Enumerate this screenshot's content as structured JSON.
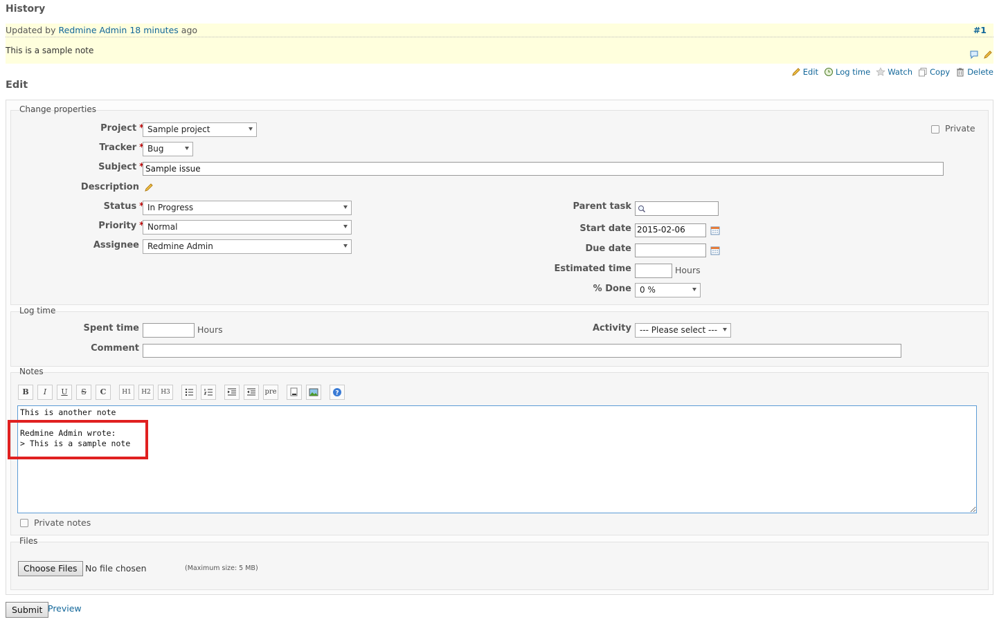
{
  "history": {
    "title": "History",
    "journal": {
      "updated_by_prefix": "Updated by",
      "author": "Redmine Admin",
      "time_ago": "18 minutes",
      "ago_suffix": "ago",
      "number": "#1",
      "note": "This is a sample note"
    }
  },
  "contextual": {
    "edit": "Edit",
    "log_time": "Log time",
    "watch": "Watch",
    "copy": "Copy",
    "delete": "Delete"
  },
  "edit_title": "Edit",
  "change_properties": {
    "legend": "Change properties",
    "project": {
      "label": "Project",
      "value": "Sample project"
    },
    "tracker": {
      "label": "Tracker",
      "value": "Bug"
    },
    "subject": {
      "label": "Subject",
      "value": "Sample issue"
    },
    "description": {
      "label": "Description"
    },
    "private_label": "Private",
    "status": {
      "label": "Status",
      "value": "In Progress"
    },
    "priority": {
      "label": "Priority",
      "value": "Normal"
    },
    "assignee": {
      "label": "Assignee",
      "value": "Redmine Admin"
    },
    "parent_task": {
      "label": "Parent task",
      "value": ""
    },
    "start_date": {
      "label": "Start date",
      "value": "2015-02-06"
    },
    "due_date": {
      "label": "Due date",
      "value": ""
    },
    "estimated_time": {
      "label": "Estimated time",
      "value": "",
      "unit": "Hours"
    },
    "done": {
      "label": "% Done",
      "value": "0 %"
    }
  },
  "log_time": {
    "legend": "Log time",
    "spent_time": {
      "label": "Spent time",
      "value": "",
      "unit": "Hours"
    },
    "activity": {
      "label": "Activity",
      "value": "--- Please select ---"
    },
    "comment": {
      "label": "Comment",
      "value": ""
    }
  },
  "notes": {
    "legend": "Notes",
    "toolbar": [
      "B",
      "I",
      "U",
      "S",
      "C",
      "H1",
      "H2",
      "H3",
      "ul",
      "ol",
      "indent",
      "outdent",
      "pre",
      "link",
      "image",
      "help"
    ],
    "text": "This is another note\n\nRedmine Admin wrote:\n> This is a sample note\n\n",
    "private_notes_label": "Private notes"
  },
  "files": {
    "legend": "Files",
    "choose_button": "Choose Files",
    "no_file": "No file chosen",
    "max_size": "(Maximum size: 5 MB)"
  },
  "actions": {
    "submit": "Submit",
    "preview": "Preview"
  }
}
